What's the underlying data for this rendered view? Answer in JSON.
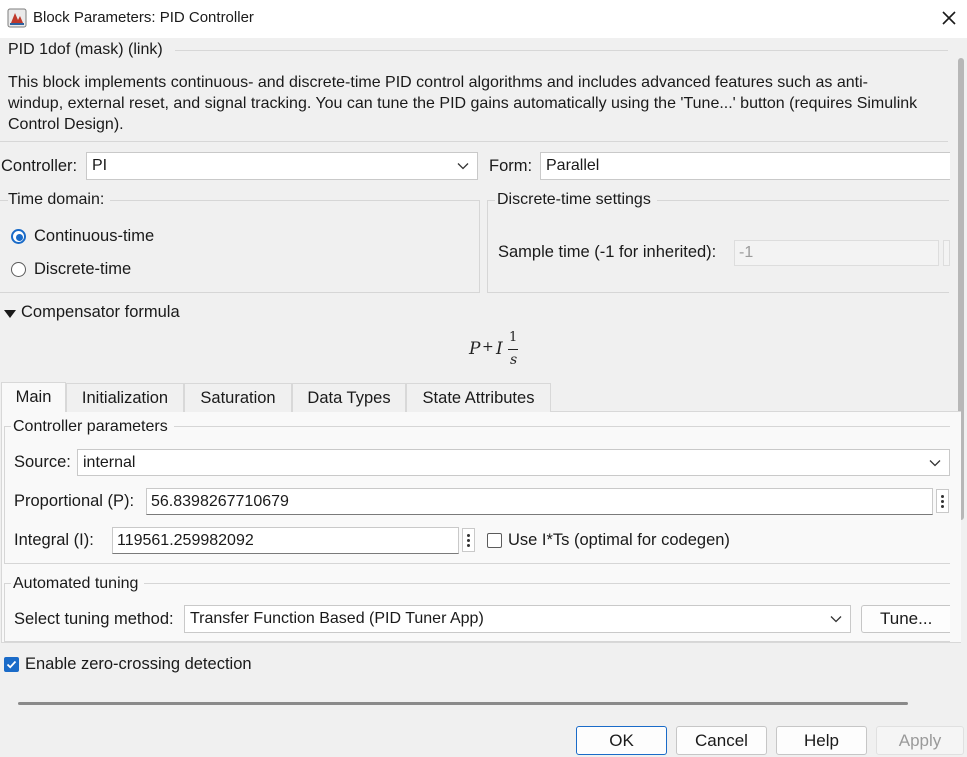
{
  "window": {
    "title": "Block Parameters: PID Controller",
    "icon": "simulink-block-icon",
    "close_icon": "close-icon"
  },
  "mask": {
    "header": "PID 1dof (mask) (link)",
    "description": "This block implements continuous- and discrete-time PID control algorithms and includes advanced features such as anti-windup, external reset, and signal tracking. You can tune the PID gains automatically using the 'Tune...' button (requires Simulink Control Design)."
  },
  "controller": {
    "label": "Controller:",
    "value": "PI",
    "form_label": "Form:",
    "form_value": "Parallel"
  },
  "time_domain": {
    "title": "Time domain:",
    "options": [
      "Continuous-time",
      "Discrete-time"
    ],
    "selected": "Continuous-time"
  },
  "discrete_settings": {
    "title": "Discrete-time settings",
    "sample_time_label": "Sample time (-1 for inherited):",
    "sample_time_value": "-1"
  },
  "compensator": {
    "label": "Compensator formula",
    "formula": {
      "p": "P",
      "plus": "+",
      "i": "I",
      "num": "1",
      "den": "s"
    }
  },
  "tabs": [
    "Main",
    "Initialization",
    "Saturation",
    "Data Types",
    "State Attributes"
  ],
  "active_tab": "Main",
  "controller_parameters": {
    "title": "Controller parameters",
    "source_label": "Source:",
    "source_value": "internal",
    "p_label": "Proportional (P):",
    "p_value": "56.8398267710679",
    "i_label": "Integral (I):",
    "i_value": "119561.259982092",
    "use_its_label": "Use I*Ts (optimal for codegen)",
    "use_its_checked": false
  },
  "automated_tuning": {
    "title": "Automated tuning",
    "method_label": "Select tuning method:",
    "method_value": "Transfer Function Based (PID Tuner App)",
    "tune_label": "Tune..."
  },
  "zero_crossing": {
    "label": "Enable zero-crossing detection",
    "checked": true
  },
  "buttons": {
    "ok": "OK",
    "cancel": "Cancel",
    "help": "Help",
    "apply": "Apply"
  },
  "colors": {
    "accent": "#1a6bc8",
    "background": "#f0f0f0",
    "panel": "#f9f9f9"
  }
}
